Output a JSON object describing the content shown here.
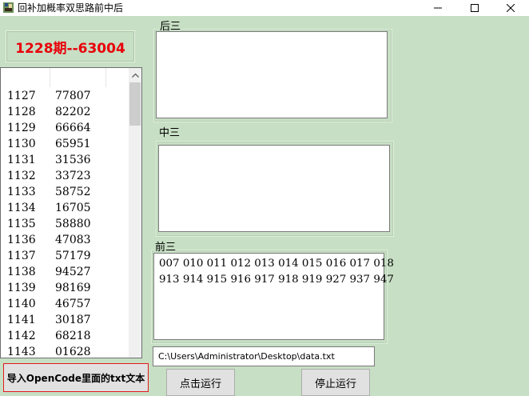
{
  "window": {
    "title": "回补加概率双思路前中后"
  },
  "period": {
    "text": "1228期--63004"
  },
  "history": {
    "rows": [
      [
        "1127",
        "77807"
      ],
      [
        "1128",
        "82202"
      ],
      [
        "1129",
        "66664"
      ],
      [
        "1130",
        "65951"
      ],
      [
        "1131",
        "31536"
      ],
      [
        "1132",
        "33723"
      ],
      [
        "1133",
        "58752"
      ],
      [
        "1134",
        "16705"
      ],
      [
        "1135",
        "58880"
      ],
      [
        "1136",
        "47083"
      ],
      [
        "1137",
        "57179"
      ],
      [
        "1138",
        "94527"
      ],
      [
        "1139",
        "98169"
      ],
      [
        "1140",
        "46757"
      ],
      [
        "1141",
        "30187"
      ],
      [
        "1142",
        "68218"
      ],
      [
        "1143",
        "01628"
      ]
    ]
  },
  "groups": {
    "back": {
      "label": "后三",
      "lines": []
    },
    "middle": {
      "label": "中三",
      "lines": []
    },
    "front": {
      "label": "前三",
      "lines": [
        "007 010 011 012 013 014 015 016 017 018",
        "913 914 915 916 917 918 919 927 937 947"
      ]
    }
  },
  "path_input": {
    "value": "C:\\Users\\Administrator\\Desktop\\data.txt"
  },
  "buttons": {
    "import": "导入OpenCode里面的txt文本",
    "run": "点击运行",
    "stop": "停止运行"
  }
}
